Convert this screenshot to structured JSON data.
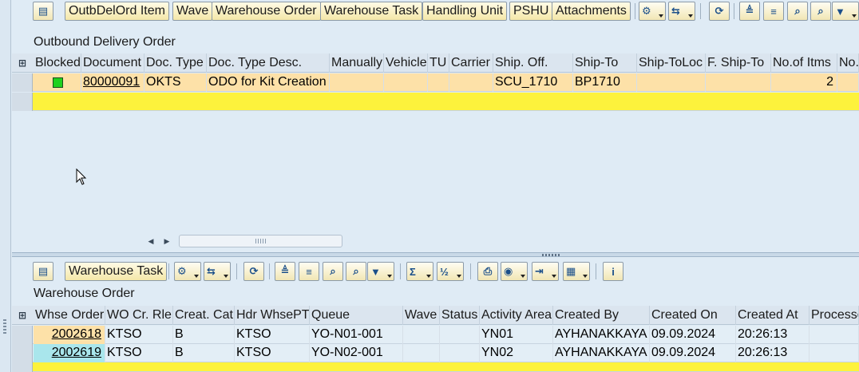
{
  "top_toolbar": {
    "buttons": [
      "OutbDelOrd Item",
      "Wave",
      "Warehouse Order",
      "Warehouse Task",
      "Handling Unit",
      "PSHU",
      "Attachments"
    ]
  },
  "top_section": {
    "title": "Outbound Delivery Order",
    "columns": [
      "Blocked",
      "Document",
      "Doc. Type",
      "Doc. Type Desc.",
      "Manually",
      "Vehicle",
      "TU",
      "Carrier",
      "Ship. Off.",
      "Ship-To",
      "Ship-ToLoc",
      "F. Ship-To",
      "No.of Itms",
      "No."
    ],
    "rows": [
      {
        "blocked_status": "green",
        "document": "80000091",
        "doc_type": "OKTS",
        "doc_type_desc": "ODO for Kit Creation",
        "manually": "",
        "vehicle": "",
        "tu": "",
        "carrier": "",
        "ship_off": "SCU_1710",
        "ship_to": "BP1710",
        "ship_to_loc": "",
        "f_ship_to": "",
        "no_of_itms": "2"
      }
    ]
  },
  "bottom_toolbar": {
    "button": "Warehouse Task"
  },
  "bottom_section": {
    "title": "Warehouse Order",
    "columns": [
      "Whse Order",
      "WO Cr. Rle",
      "Creat. Cat",
      "Hdr WhsePT",
      "Queue",
      "Wave",
      "Status",
      "Activity Area",
      "Created By",
      "Created On",
      "Created At",
      "Processor"
    ],
    "rows": [
      {
        "whse_order": "2002618",
        "wo_cr_rle": "KTSO",
        "creat_cat": "B",
        "hdr_whsept": "KTSO",
        "queue": "YO-N01-001",
        "wave": "",
        "status": "",
        "activity_area": "YN01",
        "created_by": "AYHANAKKAYA",
        "created_on": "09.09.2024",
        "created_at": "20:26:13"
      },
      {
        "whse_order": "2002619",
        "wo_cr_rle": "KTSO",
        "creat_cat": "B",
        "hdr_whsept": "KTSO",
        "queue": "YO-N02-001",
        "wave": "",
        "status": "",
        "activity_area": "YN02",
        "created_by": "AYHANAKKAYA",
        "created_on": "09.09.2024",
        "created_at": "20:26:13"
      }
    ]
  },
  "colors": {
    "selected_row": "#fde1a8",
    "highlight_row": "#fdf23c",
    "second_row_key": "#a9e6ec",
    "background": "#dfebf5"
  },
  "icons": [
    "layout-icon",
    "settings-icon",
    "export-icon",
    "refresh-icon",
    "sort-ascending-icon",
    "filter-icon",
    "find-icon",
    "find-next-icon",
    "filter-funnel-icon",
    "sum-icon",
    "subtotal-icon",
    "print-icon",
    "view-icon",
    "export-excel-icon",
    "grid-layout-icon",
    "info-icon"
  ]
}
